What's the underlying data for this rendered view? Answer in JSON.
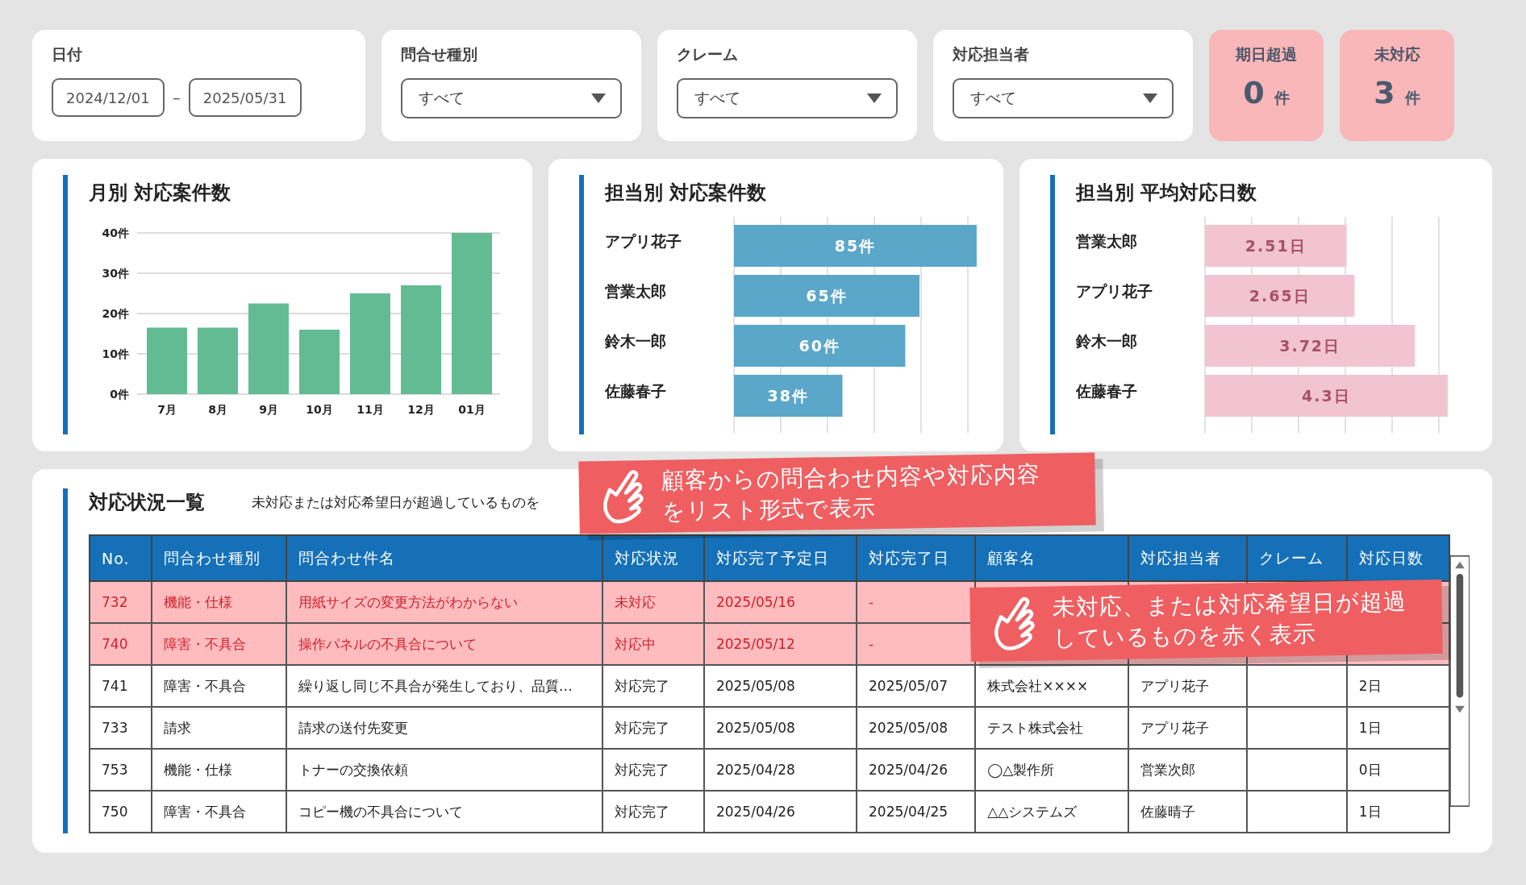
{
  "filters": {
    "date": {
      "label": "日付",
      "from": "2024/12/01",
      "separator": "–",
      "to": "2025/05/31"
    },
    "selects": [
      {
        "label": "問合せ種別",
        "value": "すべて"
      },
      {
        "label": "クレーム",
        "value": "すべて"
      },
      {
        "label": "対応担当者",
        "value": "すべて"
      }
    ],
    "counters": [
      {
        "label": "期日超過",
        "value": "0",
        "unit": "件"
      },
      {
        "label": "未対応",
        "value": "3",
        "unit": "件"
      }
    ]
  },
  "charts": [
    {
      "title": "月別 対応案件数",
      "chart_data": {
        "type": "bar",
        "categories": [
          "7月",
          "8月",
          "9月",
          "10月",
          "11月",
          "12月",
          "01月"
        ],
        "values": [
          16.5,
          16.5,
          22.5,
          16,
          25,
          27,
          40
        ],
        "ylim": [
          0,
          40
        ],
        "yticks": [
          {
            "value": 0,
            "label": "0件"
          },
          {
            "value": 10,
            "label": "10件"
          },
          {
            "value": 20,
            "label": "20件"
          },
          {
            "value": 30,
            "label": "30件"
          },
          {
            "value": 40,
            "label": "40件"
          }
        ],
        "color": "#63bb94",
        "grid": true
      }
    },
    {
      "title": "担当別 対応案件数",
      "chart_data": {
        "type": "bar",
        "orientation": "horizontal",
        "categories": [
          "アプリ花子",
          "営業太郎",
          "鈴木一郎",
          "佐藤春子"
        ],
        "values": [
          85,
          65,
          60,
          38
        ],
        "value_labels": [
          "85件",
          "65件",
          "60件",
          "38件"
        ],
        "color": "#5ba7c9",
        "grid": true
      }
    },
    {
      "title": "担当別 平均対応日数",
      "chart_data": {
        "type": "bar",
        "orientation": "horizontal",
        "categories": [
          "営業太郎",
          "アプリ花子",
          "鈴木一郎",
          "佐藤春子"
        ],
        "values": [
          2.51,
          2.65,
          3.72,
          4.3
        ],
        "value_labels": [
          "2.51日",
          "2.65日",
          "3.72日",
          "4.3日"
        ],
        "color": "#f2c4d1",
        "grid": true
      }
    }
  ],
  "table": {
    "title": "対応状況一覧",
    "note": "未対応または対応希望日が超過しているものを",
    "columns": [
      "No.",
      "問合わせ種別",
      "問合わせ件名",
      "対応状況",
      "対応完了予定日",
      "対応完了日",
      "顧客名",
      "対応担当者",
      "クレーム",
      "対応日数"
    ],
    "rows": [
      {
        "overdue": true,
        "cells": [
          "732",
          "機能・仕様",
          "用紙サイズの変更方法がわからない",
          "未対応",
          "2025/05/16",
          "-"
        ]
      },
      {
        "overdue": true,
        "cells": [
          "740",
          "障害・不具合",
          "操作パネルの不具合について",
          "対応中",
          "2025/05/12",
          "-"
        ]
      },
      {
        "overdue": false,
        "cells": [
          "741",
          "障害・不具合",
          "繰り返し同じ不具合が発生しており、品質…",
          "対応完了",
          "2025/05/08",
          "2025/05/07",
          "株式会社××××",
          "アプリ花子",
          "",
          "2日"
        ]
      },
      {
        "overdue": false,
        "cells": [
          "733",
          "請求",
          "請求の送付先変更",
          "対応完了",
          "2025/05/08",
          "2025/05/08",
          "テスト株式会社",
          "アプリ花子",
          "",
          "1日"
        ]
      },
      {
        "overdue": false,
        "cells": [
          "753",
          "機能・仕様",
          "トナーの交換依頼",
          "対応完了",
          "2025/04/28",
          "2025/04/26",
          "◯△製作所",
          "営業次郎",
          "",
          "0日"
        ]
      },
      {
        "overdue": false,
        "cells": [
          "750",
          "障害・不具合",
          "コピー機の不具合について",
          "対応完了",
          "2025/04/26",
          "2025/04/25",
          "△△システムズ",
          "佐藤晴子",
          "",
          "1日"
        ]
      }
    ]
  },
  "callouts": [
    {
      "text": "顧客からの問合わせ内容や対応内容をリスト形式で表示"
    },
    {
      "text": "未対応、または対応希望日が超過しているものを赤く表示"
    }
  ]
}
